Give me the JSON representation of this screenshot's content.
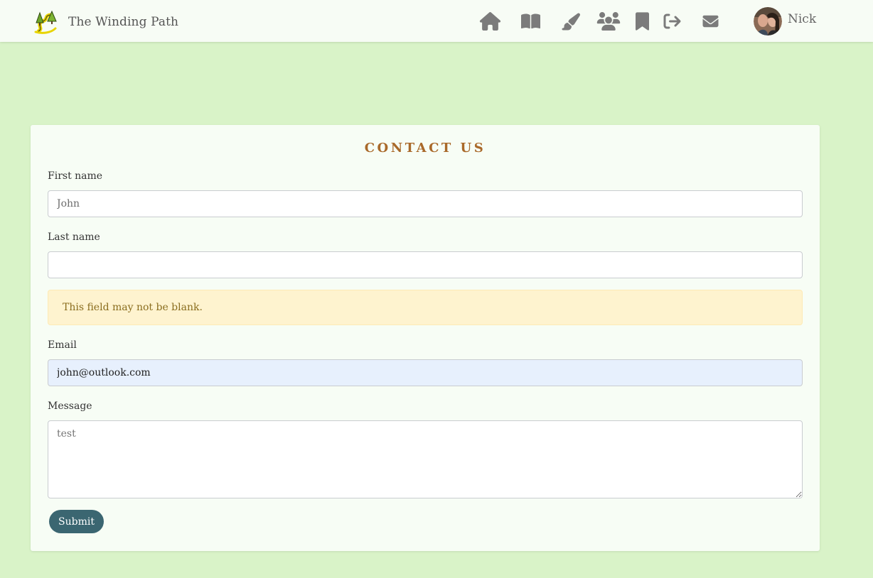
{
  "header": {
    "brand_name": "The Winding Path",
    "username": "Nick",
    "nav_icons": [
      "home-icon",
      "book-icon",
      "brush-icon",
      "users-icon",
      "bookmark-icon",
      "sign-out-icon",
      "envelope-icon"
    ]
  },
  "form": {
    "title": "CONTACT US",
    "first_name": {
      "label": "First name",
      "value": "",
      "placeholder": "John"
    },
    "last_name": {
      "label": "Last name",
      "value": "",
      "placeholder": ""
    },
    "error": "This field may not be blank.",
    "email": {
      "label": "Email",
      "value": "john@outlook.com"
    },
    "message": {
      "label": "Message",
      "value": "",
      "placeholder": "test"
    },
    "submit_label": "Submit"
  },
  "colors": {
    "page_background": "#d9f3c8",
    "card_background": "#f7fdf5",
    "title": "#a9692a",
    "submit_button": "#3b6671",
    "alert_background": "#fef3cf",
    "autofill_background": "#e7f0fd"
  }
}
